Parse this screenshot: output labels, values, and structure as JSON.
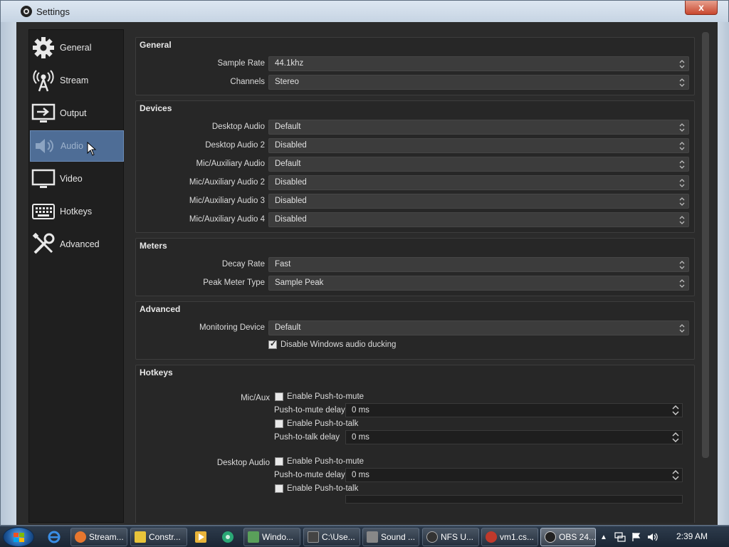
{
  "window": {
    "title": "Settings",
    "close_label": "x"
  },
  "sidebar": {
    "items": [
      {
        "label": "General",
        "icon": "gear-icon"
      },
      {
        "label": "Stream",
        "icon": "antenna-icon"
      },
      {
        "label": "Output",
        "icon": "monitor-arrow-icon"
      },
      {
        "label": "Audio",
        "icon": "speaker-icon",
        "active": true
      },
      {
        "label": "Video",
        "icon": "monitor-icon"
      },
      {
        "label": "Hotkeys",
        "icon": "keyboard-icon"
      },
      {
        "label": "Advanced",
        "icon": "tools-icon"
      }
    ]
  },
  "general": {
    "title": "General",
    "sample_rate_label": "Sample Rate",
    "sample_rate_value": "44.1khz",
    "channels_label": "Channels",
    "channels_value": "Stereo"
  },
  "devices": {
    "title": "Devices",
    "rows": [
      {
        "label": "Desktop Audio",
        "value": "Default"
      },
      {
        "label": "Desktop Audio 2",
        "value": "Disabled"
      },
      {
        "label": "Mic/Auxiliary Audio",
        "value": "Default"
      },
      {
        "label": "Mic/Auxiliary Audio 2",
        "value": "Disabled"
      },
      {
        "label": "Mic/Auxiliary Audio 3",
        "value": "Disabled"
      },
      {
        "label": "Mic/Auxiliary Audio 4",
        "value": "Disabled"
      }
    ]
  },
  "meters": {
    "title": "Meters",
    "decay_rate_label": "Decay Rate",
    "decay_rate_value": "Fast",
    "peak_meter_label": "Peak Meter Type",
    "peak_meter_value": "Sample Peak"
  },
  "advanced": {
    "title": "Advanced",
    "monitoring_label": "Monitoring Device",
    "monitoring_value": "Default",
    "ducking_label": "Disable Windows audio ducking",
    "ducking_checked": true
  },
  "hotkeys": {
    "title": "Hotkeys",
    "micaux": {
      "label": "Mic/Aux",
      "push_to_mute": "Enable Push-to-mute",
      "push_to_mute_delay_label": "Push-to-mute delay",
      "push_to_mute_delay": "0 ms",
      "push_to_talk": "Enable Push-to-talk",
      "push_to_talk_delay_label": "Push-to-talk delay",
      "push_to_talk_delay": "0 ms"
    },
    "desktop": {
      "label": "Desktop Audio",
      "push_to_mute": "Enable Push-to-mute",
      "push_to_mute_delay_label": "Push-to-mute delay",
      "push_to_mute_delay": "0 ms",
      "push_to_talk": "Enable Push-to-talk"
    }
  },
  "taskbar": {
    "buttons": [
      {
        "label": "Stream...",
        "color": "#e8772e"
      },
      {
        "label": "Constr...",
        "color": "#e8c43a"
      },
      {
        "label": "Windo...",
        "color": "#5aa05a"
      },
      {
        "label": "C:\\Use...",
        "color": "#444444"
      },
      {
        "label": "Sound ...",
        "color": "#888888"
      },
      {
        "label": "NFS U...",
        "color": "#333333"
      },
      {
        "label": "vm1.cs...",
        "color": "#c0392b"
      },
      {
        "label": "OBS 24...",
        "color": "#222222"
      }
    ],
    "clock": "2:39 AM"
  }
}
